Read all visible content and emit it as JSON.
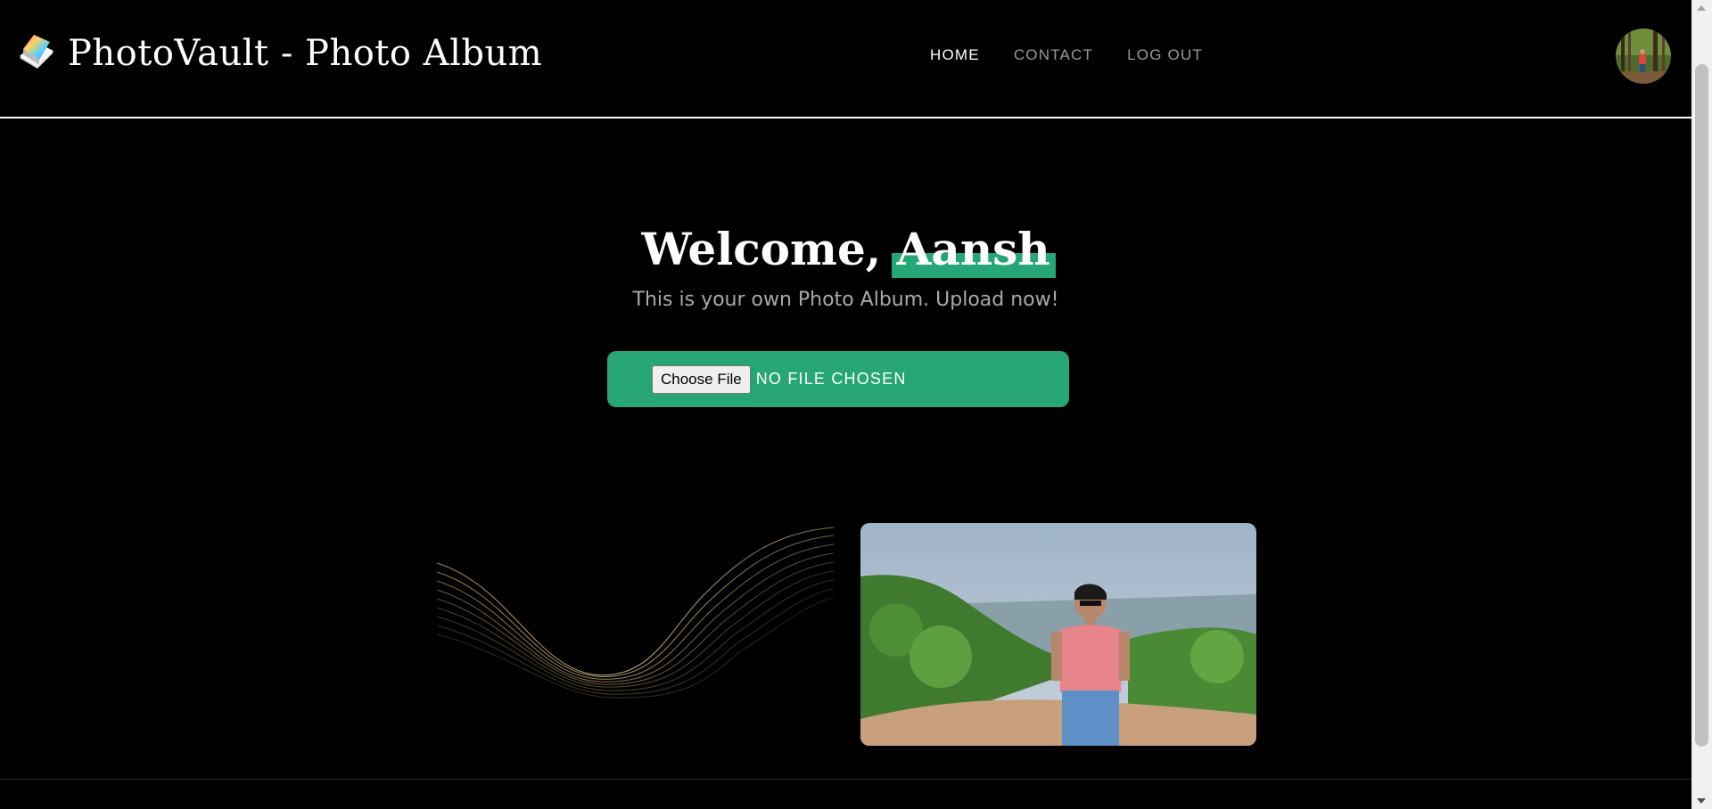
{
  "header": {
    "brand_icon": "photo-album-icon",
    "title": "PhotoVault - Photo Album",
    "nav": [
      {
        "label": "HOME",
        "active": true
      },
      {
        "label": "CONTACT",
        "active": false
      },
      {
        "label": "LOG OUT",
        "active": false
      }
    ],
    "avatar_icon": "user-avatar"
  },
  "hero": {
    "greeting": "Welcome,",
    "username": "Aansh",
    "subtitle": "This is your own Photo Album. Upload now!"
  },
  "upload": {
    "button_label": "Choose File",
    "status": "NO FILE CHOSEN"
  },
  "gallery": [
    {
      "kind": "abstract-wave-image"
    },
    {
      "kind": "person-landscape-photo"
    }
  ],
  "colors": {
    "background": "#000000",
    "accent": "#26a676",
    "text": "#ffffff",
    "muted": "#9a9a9a"
  }
}
